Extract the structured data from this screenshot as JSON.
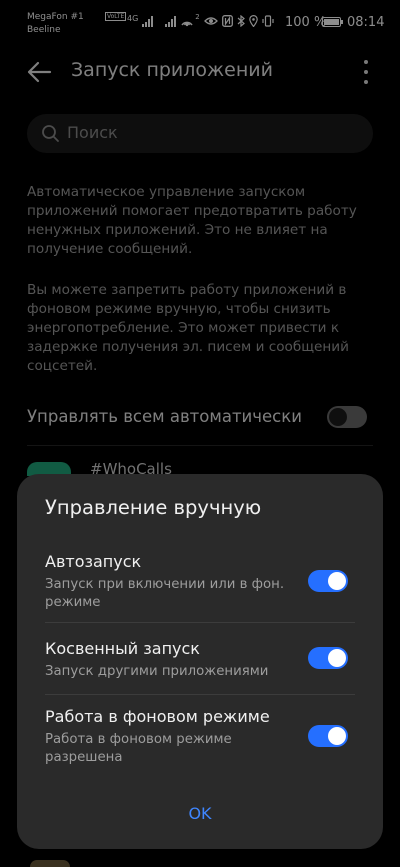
{
  "status_bar": {
    "carrier_1": "MegaFon #1",
    "volte": "VoLTE",
    "carrier_2": "Beeline",
    "network": "4G",
    "hotspot": "2",
    "battery_percent": "100 %",
    "battery_level": 1.0,
    "time": "08:14"
  },
  "header": {
    "title": "Запуск приложений",
    "back_icon": "back-arrow-icon",
    "more_icon": "more-vertical-icon"
  },
  "search": {
    "placeholder": "Поиск",
    "icon": "search-icon"
  },
  "description": {
    "paragraph_1": "Автоматическое управление запуском приложений помогает предотвратить работу ненужных приложений. Это не влияет на получение сообщений.",
    "paragraph_2": "Вы можете запретить работу приложений в фоновом режиме вручную, чтобы снизить энергопотребление. Это может привести к задержке получения эл. писем и сообщений соцсетей."
  },
  "auto_manage": {
    "label": "Управлять всем автоматически",
    "enabled": false
  },
  "app_list": [
    {
      "name": "#WhoCalls",
      "icon_color": "#1fa67a"
    }
  ],
  "dialog": {
    "title": "Управление вручную",
    "options": [
      {
        "title": "Автозапуск",
        "subtitle": "Запуск при включении или в фон. режиме",
        "enabled": true
      },
      {
        "title": "Косвенный запуск",
        "subtitle": "Запуск другими приложениями",
        "enabled": true
      },
      {
        "title": "Работа в фоновом режиме",
        "subtitle": "Работа в фоновом режиме разрешена",
        "enabled": true
      }
    ],
    "ok_label": "OK"
  },
  "colors": {
    "accent": "#256fff",
    "ok_text": "#3f86ff",
    "background": "#000000",
    "dialog_bg": "#2a2a2a"
  }
}
